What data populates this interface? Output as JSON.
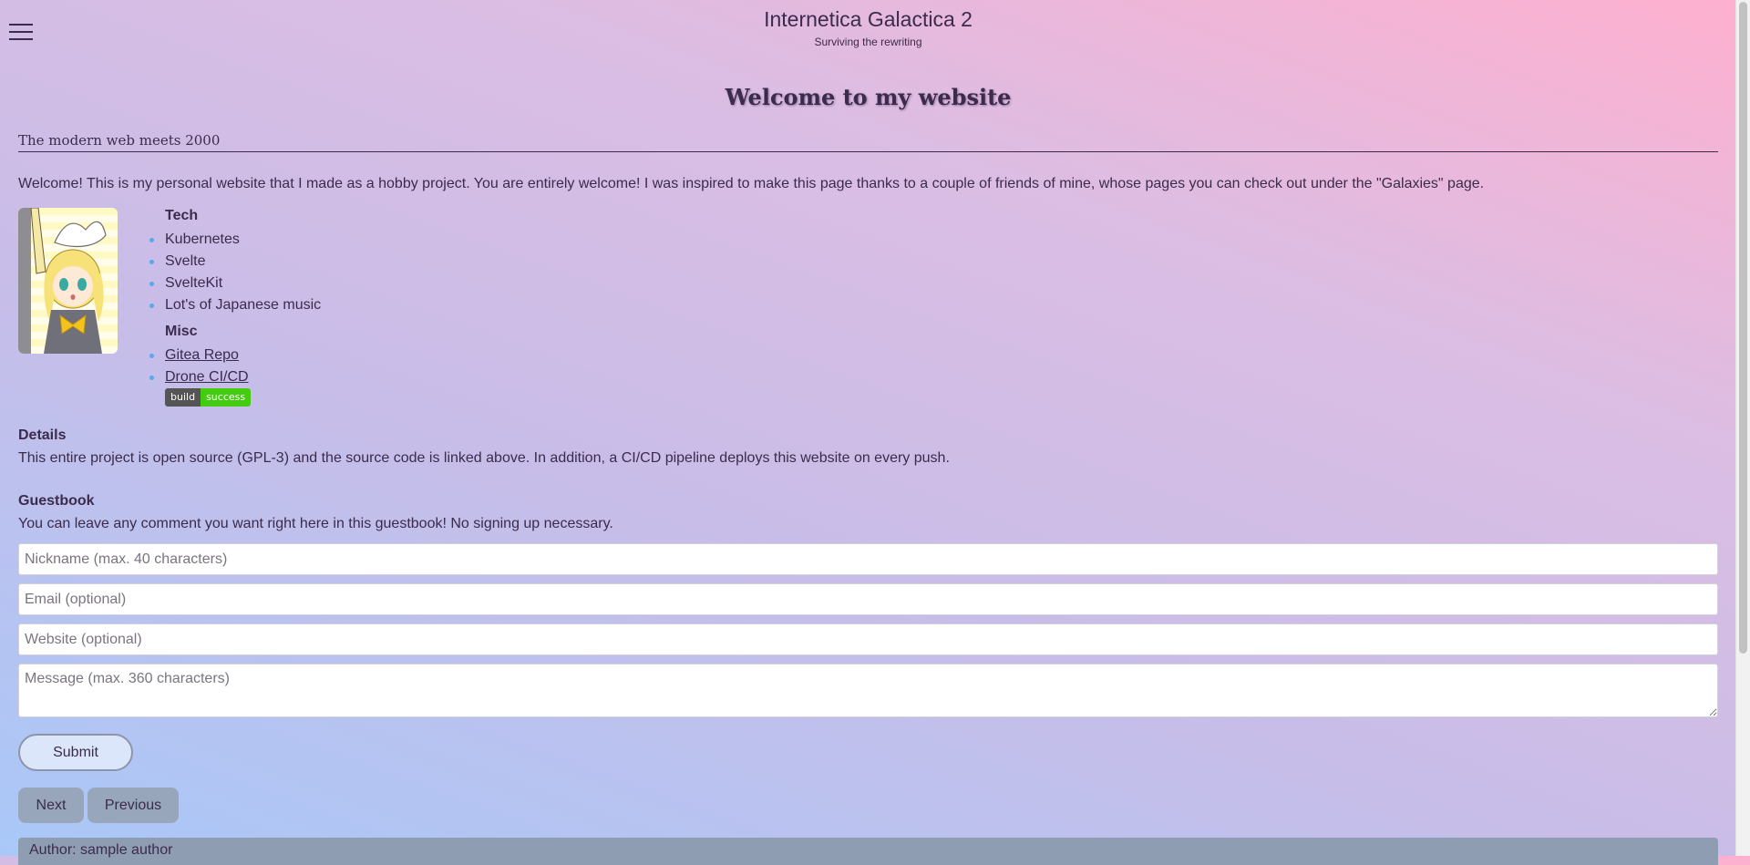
{
  "header": {
    "title": "Internetica Galactica 2",
    "subtitle": "Surviving the rewriting"
  },
  "main": {
    "heading": "Welcome to my website",
    "tagline": "The modern web meets 2000",
    "intro": "Welcome! This is my personal website that I made as a hobby project. You are entirely welcome! I was inspired to make this page thanks to a couple of friends of mine, whose pages you can check out under the \"Galaxies\" page.",
    "tech": {
      "heading": "Tech",
      "items": [
        "Kubernetes",
        "Svelte",
        "SvelteKit",
        "Lot's of Japanese music"
      ]
    },
    "misc": {
      "heading": "Misc",
      "links": [
        "Gitea Repo",
        "Drone CI/CD"
      ],
      "badge_left": "build",
      "badge_right": "success"
    },
    "details": {
      "heading": "Details",
      "text": "This entire project is open source (GPL-3) and the source code is linked above. In addition, a CI/CD pipeline deploys this website on every push."
    },
    "guestbook": {
      "heading": "Guestbook",
      "text": "You can leave any comment you want right here in this guestbook! No signing up necessary.",
      "nickname_placeholder": "Nickname (max. 40 characters)",
      "email_placeholder": "Email (optional)",
      "website_placeholder": "Website (optional)",
      "message_placeholder": "Message (max. 360 characters)",
      "submit_label": "Submit",
      "next_label": "Next",
      "previous_label": "Previous",
      "entry_author": "Author: sample author"
    }
  },
  "colors": {
    "text": "#3b2b4c",
    "bullet": "#5ea6e8",
    "badge_success": "#44cc11",
    "pager_button": "#98a6bb"
  },
  "icons": {
    "menu": "hamburger-menu-icon"
  }
}
